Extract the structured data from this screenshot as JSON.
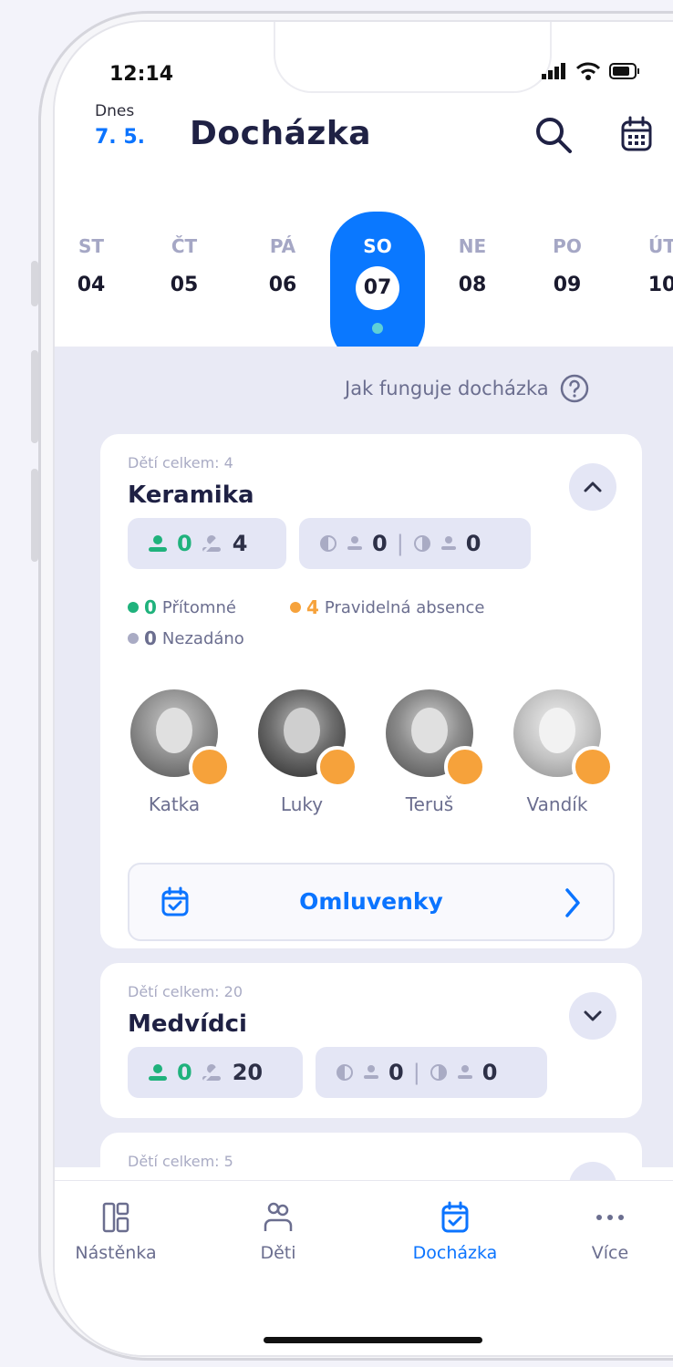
{
  "status": {
    "time": "12:14"
  },
  "header": {
    "today_label": "Dnes",
    "today_date": "7. 5.",
    "title": "Docházka",
    "search_icon": "search-icon",
    "calendar_icon": "calendar-icon"
  },
  "week": [
    {
      "name": "ST",
      "date": "04"
    },
    {
      "name": "ČT",
      "date": "05"
    },
    {
      "name": "PÁ",
      "date": "06"
    },
    {
      "name": "SO",
      "date": "07",
      "selected": true
    },
    {
      "name": "NE",
      "date": "08"
    },
    {
      "name": "PO",
      "date": "09"
    },
    {
      "name": "ÚT",
      "date": "10"
    }
  ],
  "help_link": "Jak funguje docházka",
  "groups": [
    {
      "count_label": "Dětí celkem: 4",
      "name": "Keramika",
      "expanded": true,
      "present": "0",
      "absent": "4",
      "half1": "0",
      "half2": "0",
      "legend": [
        {
          "value": "0",
          "label": "Přítomné",
          "color": "#1fb27c"
        },
        {
          "value": "4",
          "label": "Pravidelná absence",
          "color": "#f6a23b"
        },
        {
          "value": "0",
          "label": "Nezadáno",
          "color": "#a9abc4"
        }
      ],
      "kids": [
        "Katka",
        "Luky",
        "Teruš",
        "Vandík"
      ],
      "excuses_label": "Omluvenky"
    },
    {
      "count_label": "Dětí celkem: 20",
      "name": "Medvídci",
      "expanded": false,
      "present": "0",
      "absent": "20",
      "half1": "0",
      "half2": "0"
    },
    {
      "count_label": "Dětí celkem: 5"
    }
  ],
  "tabbar": [
    {
      "label": "Nástěnka",
      "icon": "dashboard-icon"
    },
    {
      "label": "Děti",
      "icon": "children-icon"
    },
    {
      "label": "Docházka",
      "icon": "attendance-icon",
      "active": true
    },
    {
      "label": "Více",
      "icon": "more-icon"
    }
  ],
  "colors": {
    "accent": "#0b74ff",
    "present": "#1fb27c",
    "absence": "#f6a23b",
    "muted": "#a9abc4"
  }
}
